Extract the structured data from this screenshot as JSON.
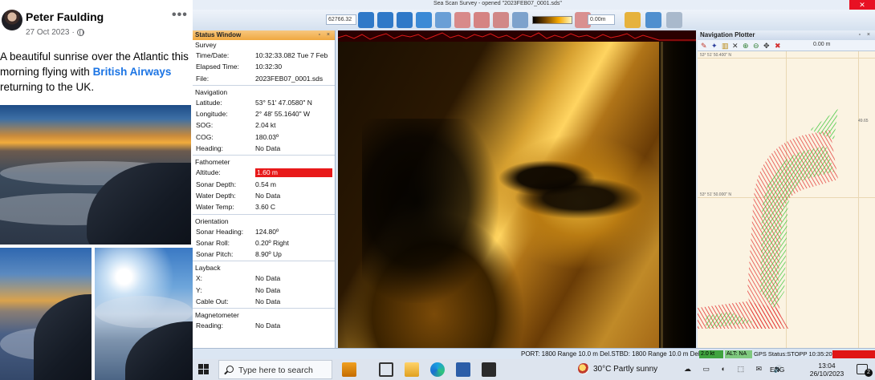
{
  "post": {
    "author": "Peter Faulding",
    "date": "27 Oct 2023",
    "more_icon": "•••",
    "text_before": "A beautiful sunrise over the Atlantic this morning flying with ",
    "link": "British Airways",
    "text_after": " returning to the UK."
  },
  "sonar_app": {
    "window_title": "Sea Scan Survey - opened \"2023FEB07_0001.sds\"",
    "close_glyph": "✕",
    "toolbar": {
      "coord_field": "62766.32",
      "range_field": "0.00m"
    },
    "status_window": {
      "title": "Status Window",
      "controls": "▫ ×",
      "survey": {
        "heading": "Survey",
        "rows": [
          {
            "label": "Time/Date:",
            "value": "10:32:33.082 Tue 7 Feb"
          },
          {
            "label": "Elapsed Time:",
            "value": "10:32:30"
          },
          {
            "label": "File:",
            "value": "2023FEB07_0001.sds"
          }
        ]
      },
      "navigation": {
        "heading": "Navigation",
        "rows": [
          {
            "label": "Latitude:",
            "value": "53° 51' 47.0580\" N"
          },
          {
            "label": "Longitude:",
            "value": "2° 48' 55.1640\" W"
          },
          {
            "label": "SOG:",
            "value": "2.04 kt"
          },
          {
            "label": "COG:",
            "value": "180.03º"
          },
          {
            "label": "Heading:",
            "value": "No Data"
          }
        ]
      },
      "fathometer": {
        "heading": "Fathometer",
        "rows": [
          {
            "label": "Altitude:",
            "value": "1.60 m"
          },
          {
            "label": "Sonar Depth:",
            "value": "0.54 m"
          },
          {
            "label": "Water Depth:",
            "value": "No Data"
          },
          {
            "label": "Water Temp:",
            "value": "3.60 C"
          }
        ]
      },
      "orientation": {
        "heading": "Orientation",
        "rows": [
          {
            "label": "Sonar Heading:",
            "value": "124.80º"
          },
          {
            "label": "Sonar Roll:",
            "value": "0.20º Right"
          },
          {
            "label": "Sonar Pitch:",
            "value": "8.90º Up"
          }
        ]
      },
      "layback": {
        "heading": "Layback",
        "rows": [
          {
            "label": "X:",
            "value": "No Data"
          },
          {
            "label": "Y:",
            "value": "No Data"
          },
          {
            "label": "Cable Out:",
            "value": "No Data"
          }
        ]
      },
      "magnetometer": {
        "heading": "Magnetometer",
        "rows": [
          {
            "label": "Reading:",
            "value": "No Data"
          }
        ]
      }
    },
    "nav_plotter": {
      "title": "Navigation Plotter",
      "controls": "▫ ×",
      "scale": "0.00 m",
      "coord_top": "53° 51' 50.400\" N",
      "coord_mid": "53° 51' 50.000\" N",
      "coord_right": "49.65"
    },
    "status_bar": {
      "text": "PORT: 1800 Range 10.0 m Del.STBD: 1800 Range 10.0 m Del",
      "green_badge": "2.0 kt",
      "alt": "ALT: NA",
      "gps": "GPS Status:STOPP 10:35:20"
    },
    "colors": {
      "alert_red": "#e8191a",
      "track_green": "#2fc42f",
      "track_red": "#e01a1a",
      "panel_orange": "#f0a840"
    }
  },
  "taskbar": {
    "search_placeholder": "Type here to search",
    "weather": "30°C  Partly sunny",
    "language": "ENG",
    "time": "13:04",
    "date": "26/10/2023",
    "notification_count": "2"
  }
}
